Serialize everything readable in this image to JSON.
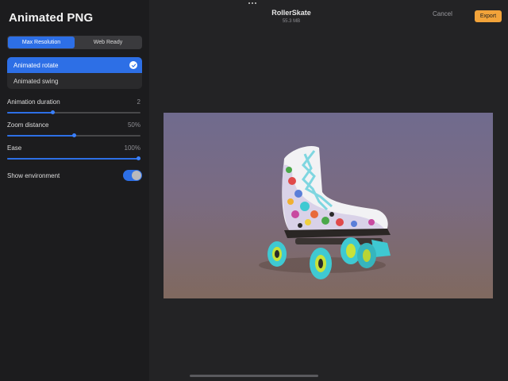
{
  "panel": {
    "title": "Animated PNG",
    "segmented": [
      "Max Resolution",
      "Web Ready"
    ],
    "options": [
      {
        "label": "Animated rotate",
        "selected": true
      },
      {
        "label": "Animated swing",
        "selected": false
      }
    ],
    "sliders": [
      {
        "label": "Animation duration",
        "value": "2",
        "fraction": 0.34
      },
      {
        "label": "Zoom distance",
        "value": "50%",
        "fraction": 0.5
      },
      {
        "label": "Ease",
        "value": "100%",
        "fraction": 1.0
      }
    ],
    "toggle": {
      "label": "Show environment",
      "on": true
    }
  },
  "header": {
    "title": "RollerSkate",
    "size": "55.3 MB",
    "cancel": "Cancel",
    "export": "Export"
  },
  "colors": {
    "accent": "#2d6fe6",
    "export": "#f2a33a",
    "wheel": "#3fc9d2",
    "preview_bg_top": "#706b8e",
    "preview_bg_bottom": "#80695f"
  },
  "icons": {
    "selected_check": "checkmark-icon",
    "more": "ellipsis-icon"
  }
}
